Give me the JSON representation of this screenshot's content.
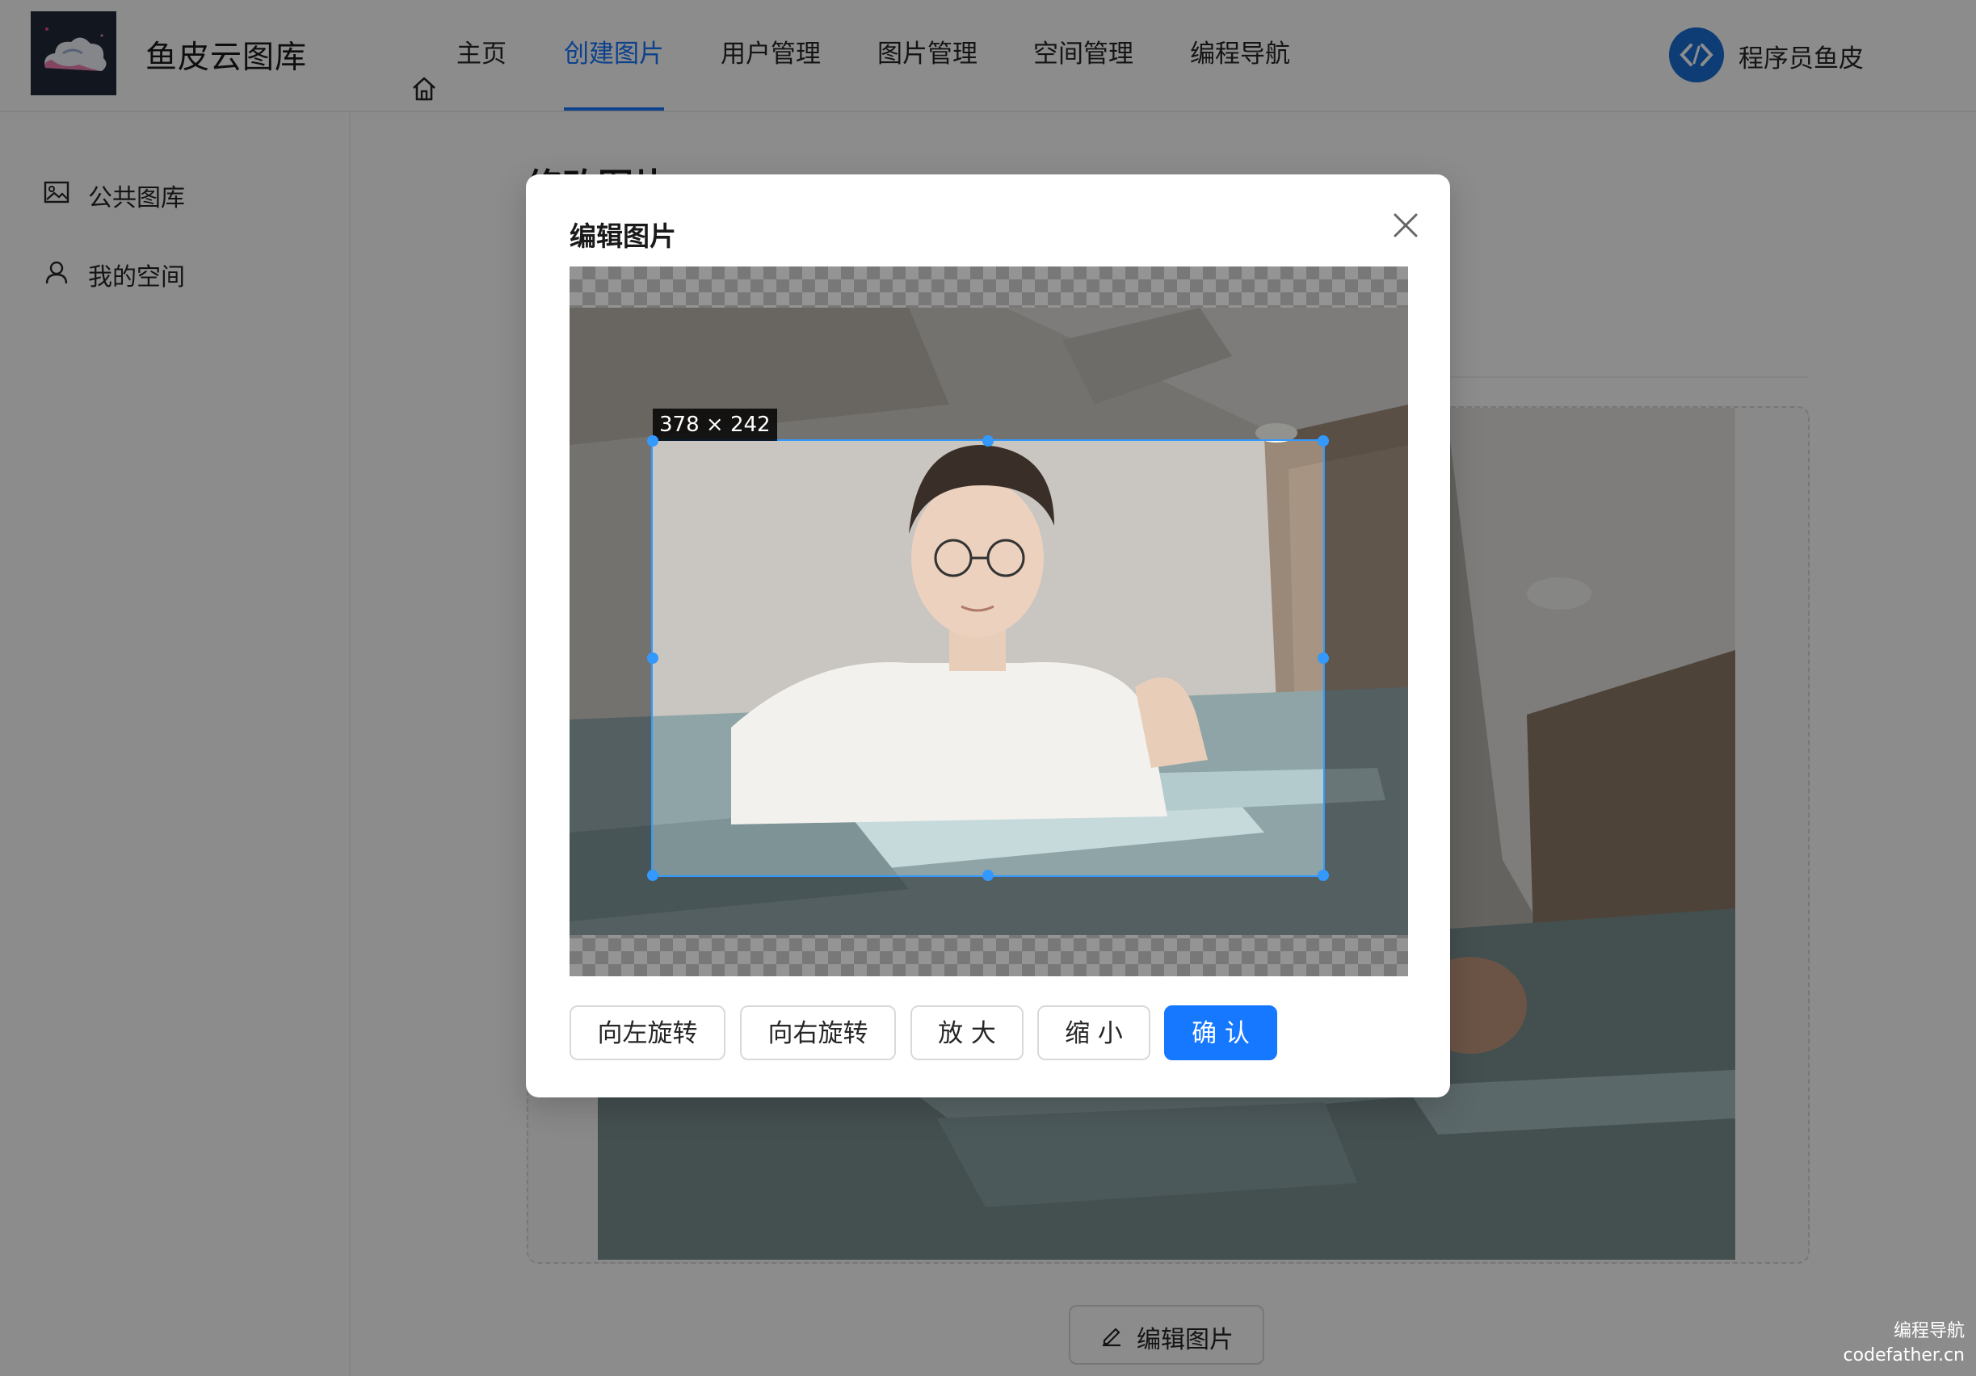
{
  "header": {
    "site_title": "鱼皮云图库",
    "nav": [
      {
        "label": "主页",
        "icon": "home-icon"
      },
      {
        "label": "创建图片",
        "active": true
      },
      {
        "label": "用户管理"
      },
      {
        "label": "图片管理"
      },
      {
        "label": "空间管理"
      },
      {
        "label": "编程导航"
      }
    ],
    "user_name": "程序员鱼皮"
  },
  "sidebar": {
    "items": [
      {
        "label": "公共图库",
        "icon": "picture-icon"
      },
      {
        "label": "我的空间",
        "icon": "user-icon"
      }
    ]
  },
  "page": {
    "title": "修改图片",
    "edit_button": "编辑图片"
  },
  "modal": {
    "title": "编辑图片",
    "crop_size": "378 × 242",
    "buttons": {
      "rotate_left": "向左旋转",
      "rotate_right": "向右旋转",
      "zoom_in": "放 大",
      "zoom_out": "缩 小",
      "confirm": "确 认"
    }
  },
  "watermark": {
    "line1": "编程导航",
    "line2": "codefather.cn"
  },
  "colors": {
    "primary": "#1677ff",
    "crop_accent": "#3399ff"
  }
}
